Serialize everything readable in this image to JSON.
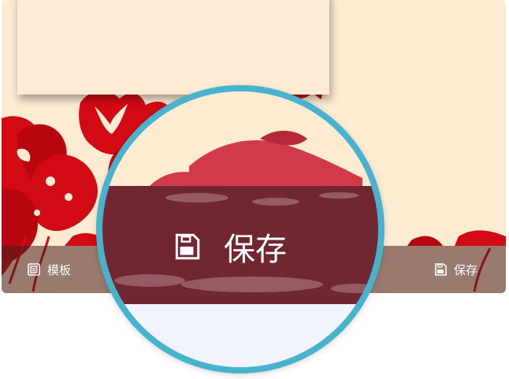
{
  "toolbar": {
    "template_label": "模板",
    "save_label": "保存"
  },
  "magnifier": {
    "save_label": "保存"
  },
  "colors": {
    "card_background": "#fdebd2",
    "papercut_red": "#d20a14",
    "toolbar_overlay": "#46201e",
    "lens_border": "#47b3cc"
  },
  "icons": {
    "template": "template-icon",
    "save": "save-icon"
  }
}
